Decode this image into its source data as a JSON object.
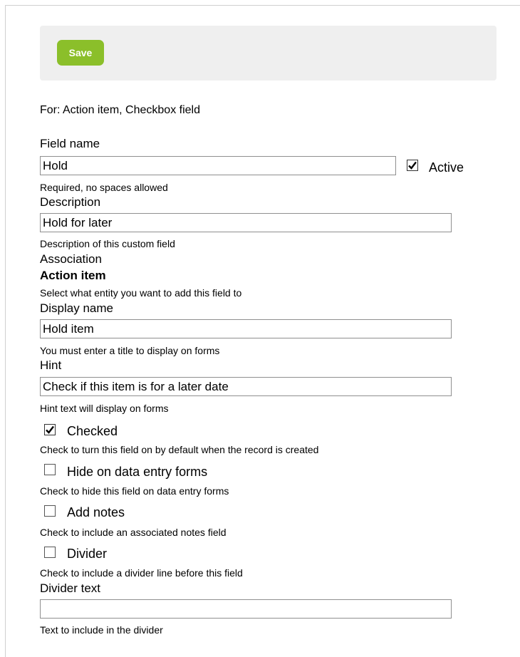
{
  "toolbar": {
    "save_label": "Save"
  },
  "context_line": "For: Action item, Checkbox field",
  "field_name": {
    "label": "Field name",
    "value": "Hold",
    "help": "Required, no spaces allowed",
    "active_label": "Active",
    "active_checked": true
  },
  "description": {
    "label": "Description",
    "value": "Hold for later",
    "help": "Description of this custom field"
  },
  "association": {
    "label": "Association",
    "value": "Action item",
    "help": "Select what entity you want to add this field to"
  },
  "display_name": {
    "label": "Display name",
    "value": "Hold item",
    "help": "You must enter a title to display on forms"
  },
  "hint": {
    "label": "Hint",
    "value": "Check if this item is for a later date",
    "help": "Hint text will display on forms"
  },
  "checked": {
    "label": "Checked",
    "checked": true,
    "help": "Check to turn this field on by default when the record is created"
  },
  "hide_on_forms": {
    "label": "Hide on data entry forms",
    "checked": false,
    "help": "Check to hide this field on data entry forms"
  },
  "add_notes": {
    "label": "Add notes",
    "checked": false,
    "help": "Check to include an associated notes field"
  },
  "divider": {
    "label": "Divider",
    "checked": false,
    "help": "Check to include a divider line before this field"
  },
  "divider_text": {
    "label": "Divider text",
    "value": "",
    "help": "Text to include in the divider"
  },
  "colors": {
    "save_button": "#8bbf2a",
    "toolbar_bg": "#efefef"
  }
}
